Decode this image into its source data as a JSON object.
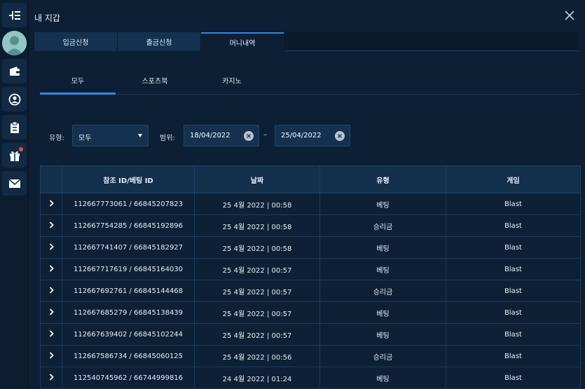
{
  "window": {
    "title": "내 지갑"
  },
  "tabs": [
    {
      "label": "입금신청",
      "active": false
    },
    {
      "label": "출금신청",
      "active": false
    },
    {
      "label": "머니내역",
      "active": true
    }
  ],
  "subtabs": [
    {
      "label": "모두",
      "active": true
    },
    {
      "label": "스포츠북",
      "active": false
    },
    {
      "label": "카지노",
      "active": false
    }
  ],
  "filters": {
    "type_label": "유형:",
    "type_value": "모두",
    "range_label": "범위:",
    "date_from": "18/04/2022",
    "date_separator": "–",
    "date_to": "25/04/2022"
  },
  "table": {
    "headers": [
      "참조 ID/베팅 ID",
      "날짜",
      "유형",
      "게임"
    ],
    "rows": [
      {
        "ref": "112667773061 / 66845207823",
        "date": "25 4월 2022 | 00:58",
        "type": "베팅",
        "game": "Blast"
      },
      {
        "ref": "112667754285 / 66845192896",
        "date": "25 4월 2022 | 00:58",
        "type": "승리금",
        "game": "Blast"
      },
      {
        "ref": "112667741407 / 66845182927",
        "date": "25 4월 2022 | 00:58",
        "type": "베팅",
        "game": "Blast"
      },
      {
        "ref": "112667717619 / 66845164030",
        "date": "25 4월 2022 | 00:57",
        "type": "베팅",
        "game": "Blast"
      },
      {
        "ref": "112667692761 / 66845144468",
        "date": "25 4월 2022 | 00:57",
        "type": "승리금",
        "game": "Blast"
      },
      {
        "ref": "112667685279 / 66845138439",
        "date": "25 4월 2022 | 00:57",
        "type": "베팅",
        "game": "Blast"
      },
      {
        "ref": "112667639402 / 66845102244",
        "date": "25 4월 2022 | 00:57",
        "type": "베팅",
        "game": "Blast"
      },
      {
        "ref": "112667586734 / 66845060125",
        "date": "25 4월 2022 | 00:56",
        "type": "승리금",
        "game": "Blast"
      },
      {
        "ref": "112540745962 / 66744999816",
        "date": "24 4월 2022 | 01:24",
        "type": "베팅",
        "game": "Blast"
      }
    ]
  },
  "sidebar": {
    "icons": [
      "menu-collapse-icon",
      "avatar",
      "wallet-icon",
      "profile-icon",
      "clipboard-icon",
      "gift-icon",
      "mail-icon"
    ]
  },
  "colors": {
    "accent": "#2d8ae0",
    "notification": "#f0454b"
  }
}
